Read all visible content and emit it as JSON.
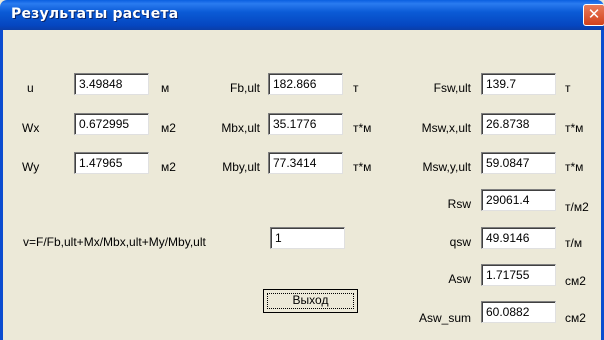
{
  "window": {
    "title": "Результаты расчета",
    "close_icon": "✕"
  },
  "left": [
    {
      "label": "u",
      "value": "3.49848",
      "unit": "м"
    },
    {
      "label": "Wx",
      "value": "0.672995",
      "unit": "м2"
    },
    {
      "label": "Wy",
      "value": "1.47965",
      "unit": "м2"
    }
  ],
  "middle": [
    {
      "label": "Fb,ult",
      "value": "182.866",
      "unit": "т"
    },
    {
      "label": "Mbx,ult",
      "value": "35.1776",
      "unit": "т*м"
    },
    {
      "label": "Mby,ult",
      "value": "77.3414",
      "unit": "т*м"
    }
  ],
  "right": [
    {
      "label": "Fsw,ult",
      "value": "139.7",
      "unit": "т"
    },
    {
      "label": "Msw,x,ult",
      "value": "26.8738",
      "unit": "т*м"
    },
    {
      "label": "Msw,y,ult",
      "value": "59.0847",
      "unit": "т*м"
    },
    {
      "label": "Rsw",
      "value": "29061.4",
      "unit": "т/м2"
    },
    {
      "label": "qsw",
      "value": "49.9146",
      "unit": "т/м"
    },
    {
      "label": "Asw",
      "value": "1.71755",
      "unit": "см2"
    },
    {
      "label": "Asw_sum",
      "value": "60.0882",
      "unit": "см2"
    }
  ],
  "ratio": {
    "label": "v=F/Fb,ult+Mx/Mbx,ult+My/Mby,ult",
    "value": "1"
  },
  "exit_button": {
    "label": "Выход"
  },
  "colors": {
    "title_bar": "#0b5bd6",
    "dialog_bg": "#ece9d8",
    "close_button": "#d2421c"
  }
}
